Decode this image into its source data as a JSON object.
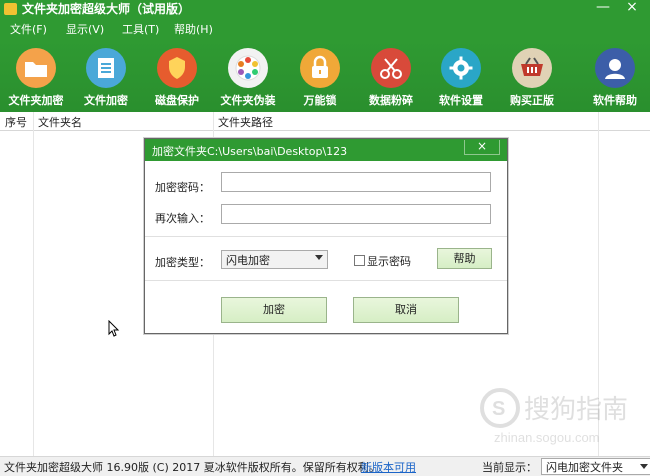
{
  "app": {
    "title": "文件夹加密超级大师（试用版）"
  },
  "menu": {
    "items": [
      "文件(F)",
      "显示(V)",
      "工具(T)",
      "帮助(H)"
    ]
  },
  "toolbar": {
    "items": [
      {
        "label": "文件夹加密",
        "icon": "folder-icon",
        "color": "#f4a24a"
      },
      {
        "label": "文件加密",
        "icon": "document-icon",
        "color": "#4aa8d8"
      },
      {
        "label": "磁盘保护",
        "icon": "shield-icon",
        "color": "#e65c2e"
      },
      {
        "label": "文件夹伪装",
        "icon": "palette-icon",
        "color": "#f2f2f2"
      },
      {
        "label": "万能锁",
        "icon": "padlock-icon",
        "color": "#f0a838"
      },
      {
        "label": "数据粉碎",
        "icon": "scissors-icon",
        "color": "#d84a3a"
      },
      {
        "label": "软件设置",
        "icon": "gear-icon",
        "color": "#2aa6c7"
      },
      {
        "label": "购买正版",
        "icon": "cart-icon",
        "color": "#e0d2b5"
      },
      {
        "label": "软件帮助",
        "icon": "user-help-icon",
        "color": "#3c5ea8"
      }
    ]
  },
  "table": {
    "columns": [
      "序号",
      "文件夹名",
      "文件夹路径"
    ]
  },
  "dialog": {
    "title": "加密文件夹C:\\Users\\bai\\Desktop\\123",
    "close": "×",
    "password_label": "加密密码：",
    "confirm_label": "再次输入：",
    "type_label": "加密类型：",
    "type_value": "闪电加密",
    "show_password": "显示密码",
    "help": "帮助",
    "encrypt": "加密",
    "cancel": "取消"
  },
  "status": {
    "copyright": "文件夹加密超级大师 16.90版 (C) 2017  夏冰软件版权所有。保留所有权利。",
    "link": "新版本可用",
    "current_label": "当前显示：",
    "current_value": "闪电加密文件夹"
  },
  "watermark": {
    "line1": "搜狗指南",
    "line2": "zhinan.sogou.com"
  },
  "colors": {
    "accent": "#2f9a32",
    "button": "#d6eec5",
    "link": "#1a64c8"
  }
}
